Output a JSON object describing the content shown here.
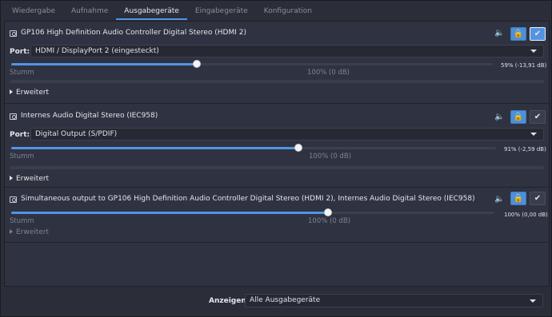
{
  "tabs": [
    {
      "label": "Wiedergabe"
    },
    {
      "label": "Aufnahme"
    },
    {
      "label": "Ausgabegeräte"
    },
    {
      "label": "Eingabegeräte"
    },
    {
      "label": "Konfiguration"
    }
  ],
  "active_tab": "Ausgabegeräte",
  "devices": [
    {
      "name": "GP106 High Definition Audio Controller Digital Stereo (HDMI 2)",
      "port_label": "Port:",
      "port_value": "HDMI / DisplayPort 2 (eingesteckt)",
      "volume_text": "59% (-13,91 dB)",
      "volume_percent": 59,
      "mute_label": "Stumm",
      "hundred_label": "100% (0 dB)",
      "advanced_label": "Erweitert",
      "default_checked": true
    },
    {
      "name": "Internes Audio Digital Stereo (IEC958)",
      "port_label": "Port:",
      "port_value": "Digital Output (S/PDIF)",
      "volume_text": "91% (-2,59 dB)",
      "volume_percent": 91,
      "mute_label": "Stumm",
      "hundred_label": "100% (0 dB)",
      "advanced_label": "Erweitert",
      "default_checked": false
    },
    {
      "name": "Simultaneous output to GP106 High Definition Audio Controller Digital Stereo (HDMI 2), Internes Audio Digital Stereo (IEC958)",
      "volume_text": "100% (0,00 dB)",
      "volume_percent": 100,
      "mute_label": "Stumm",
      "hundred_label": "100% (0 dB)",
      "advanced_label": "Erweitert",
      "default_checked": false
    }
  ],
  "footer": {
    "show_label": "Anzeigen:",
    "show_value": "Alle Ausgabegeräte"
  },
  "colors": {
    "accent": "#5294e2",
    "lock": "#f3c24b"
  },
  "icons": [
    "device-icon",
    "speaker-icon",
    "lock-icon",
    "check-icon",
    "chevron-down-icon",
    "expander-arrow-icon"
  ]
}
